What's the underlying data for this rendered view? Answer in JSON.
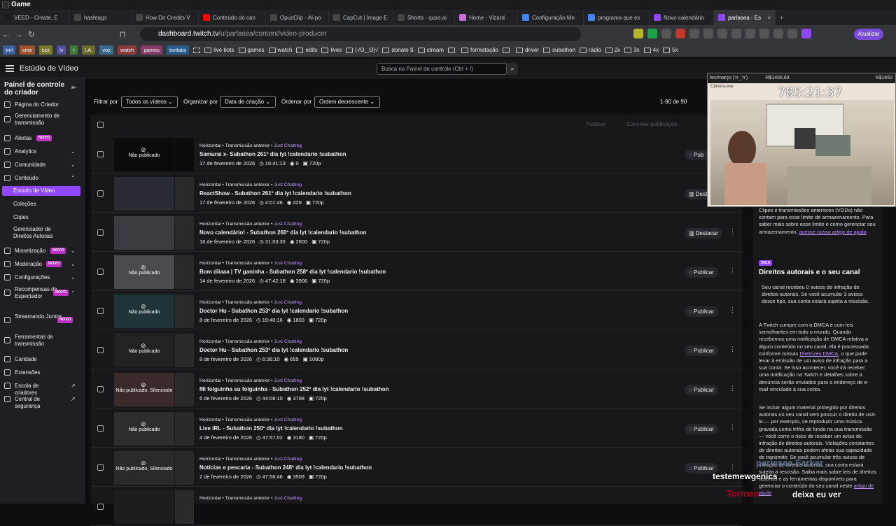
{
  "os": {
    "title": "Game"
  },
  "tabs": [
    {
      "label": "VEED - Create, E",
      "color": "#1c1c1c"
    },
    {
      "label": "hashtags",
      "color": "#444"
    },
    {
      "label": "How Do Credits V",
      "color": "#444"
    },
    {
      "label": "Conteúdo do can",
      "color": "#ff0000"
    },
    {
      "label": "OpusClip - AI-po",
      "color": "#444"
    },
    {
      "label": "CapCut | Image E",
      "color": "#444"
    },
    {
      "label": "Shorts - quso.ai",
      "color": "#444"
    },
    {
      "label": "Home - Vizard",
      "color": "#c86dd7"
    },
    {
      "label": "Configuração Me",
      "color": "#4285f4"
    },
    {
      "label": "programa que ex",
      "color": "#4285f4"
    },
    {
      "label": "Novo calendário",
      "color": "#9147ff"
    },
    {
      "label": "parlasea - Es",
      "color": "#9147ff",
      "active": true
    }
  ],
  "url": {
    "host": "dashboard.twitch.tv",
    "path": "/u/parlasea/content/video-producer"
  },
  "update_label": "Atualizar",
  "bookmarks": {
    "chips": [
      {
        "label": "tml",
        "color": "#3b5f9a"
      },
      {
        "label": "cine",
        "color": "#a0522d"
      },
      {
        "label": "ccz",
        "color": "#7a7a2a"
      },
      {
        "label": "lv",
        "color": "#4f4f9a"
      },
      {
        "label": "r",
        "color": "#3f7a3f"
      },
      {
        "label": "I.A.",
        "color": "#6b6b2a"
      },
      {
        "label": "voz",
        "color": "#3a6a8a"
      },
      {
        "label": "watch",
        "color": "#8a3a3a"
      },
      {
        "label": "games",
        "color": "#8a3a6a"
      },
      {
        "label": "botlabs",
        "color": "#2a5a8a"
      }
    ],
    "items": [
      "live bots",
      "games",
      "watch",
      "edits",
      "lives",
      "(√ʘ‿ʘ)√",
      "donate $",
      "stream",
      "",
      "formatação",
      "",
      "driver",
      "subathon",
      "rádio",
      "2x",
      "3x",
      "4x",
      "5x"
    ]
  },
  "header": {
    "studio_title": "Estúdio de Vídeo",
    "search_placeholder": "Busca no Painel de controle (Ctrl + /)"
  },
  "sidebar": {
    "title": "Painel de controle do criador",
    "new_badge": "NOVO",
    "items": [
      "Página do Criador",
      "Gerenciamento de transmissão",
      "Alertas",
      "Analytics",
      "Comunidade",
      "Conteúdo",
      "Estúdio de Vídeo",
      "Coleções",
      "Clipes",
      "Gerenciador de Direitos Autorais",
      "Monetização",
      "Moderação",
      "Configurações",
      "Recompensas de Espectador",
      "Streamando Juntos",
      "Ferramentas de transmissão",
      "Caridade",
      "Extensões",
      "Escola de criadores",
      "Central de segurança"
    ]
  },
  "filters": {
    "filter_label": "Filtrar por",
    "filter_value": "Todos os vídeos",
    "sort_label": "Organizar por",
    "sort_value": "Data de criação",
    "order_label": "Ordenar por",
    "order_value": "Ordem decrescente",
    "count": "1-90 de 90"
  },
  "list_header": {
    "publish": "Publicar",
    "cancel": "Cancelar publicação"
  },
  "rows": [
    {
      "meta": "Horizontal • Transmissão anterior •",
      "cat": "Just Chatting",
      "title": "Samurai x- Subathon 261º dia lyt !calendario !subathon",
      "date": "17 de fevereiro de 2026",
      "dur": "16:41:13",
      "views": "0",
      "res": "720p",
      "status": "Não publicado",
      "action": "Pub"
    },
    {
      "meta": "Horizontal • Transmissão anterior •",
      "cat": "Just Chatting",
      "title": "ReactShow - Subathon 261º dia lyt !calendario !subathon",
      "date": "17 de fevereiro de 2026",
      "dur": "4:01:46",
      "views": "429",
      "res": "720p",
      "status": "",
      "action": "Dest"
    },
    {
      "meta": "Horizontal • Transmissão anterior •",
      "cat": "Just Chatting",
      "title": "Novo calendário! - Subathon 260º dia lyt !calendario !subathon",
      "date": "16 de fevereiro de 2026",
      "dur": "31:03:35",
      "views": "2600",
      "res": "720p",
      "status": "",
      "action": "Destacar"
    },
    {
      "meta": "Horizontal • Transmissão anterior •",
      "cat": "Just Chatting",
      "title": "Bom diiaaa | TV ganinha - Subathon 258º dia lyt !calendario !subathon",
      "date": "14 de fevereiro de 2026",
      "dur": "47:42:18",
      "views": "3906",
      "res": "720p",
      "status": "Não publicado",
      "action": "Publicar"
    },
    {
      "meta": "Horizontal • Transmissão anterior •",
      "cat": "Just Chatting",
      "title": "Doctor Hu - Subathon 253º dia lyt !calendario !subathon",
      "date": "8 de fevereiro de 2026",
      "dur": "19:40:16",
      "views": "1803",
      "res": "720p",
      "status": "Não publicado",
      "action": "Publicar"
    },
    {
      "meta": "Horizontal • Transmissão anterior •",
      "cat": "Just Chatting",
      "title": "Doctor Hu - Subathon 253º dia lyt !calendario !subathon",
      "date": "8 de fevereiro de 2026",
      "dur": "6:36:10",
      "views": "655",
      "res": "1080p",
      "status": "Não publicado",
      "action": "Publicar"
    },
    {
      "meta": "Horizontal • Transmissão anterior •",
      "cat": "Just Chatting",
      "title": "Mi folguinha su folguinha - Subathon 252º dia lyt !calendario !subathon",
      "date": "6 de fevereiro de 2026",
      "dur": "44:08:10",
      "views": "3798",
      "res": "720p",
      "status": "Não publicado, Silenciado",
      "action": "Publicar"
    },
    {
      "meta": "Horizontal • Transmissão anterior •",
      "cat": "Just Chatting",
      "title": "Live IRL - Subathon 250º dia lyt !calendario !subathon",
      "date": "4 de fevereiro de 2026",
      "dur": "47:57:02",
      "views": "3180",
      "res": "720p",
      "status": "Não publicado",
      "action": "Publicar"
    },
    {
      "meta": "Horizontal • Transmissão anterior •",
      "cat": "Just Chatting",
      "title": "Notícias e pescaria - Subathon 248º dia lyt !calendario !subathon",
      "date": "2 de fevereiro de 2026",
      "dur": "47:56:46",
      "views": "3509",
      "res": "720p",
      "status": "Não publicado, Silenciado",
      "action": "Publicar"
    },
    {
      "meta": "Horizontal • Transmissão anterior •",
      "cat": "Just Chatting",
      "title": "",
      "date": "",
      "dur": "",
      "views": "",
      "res": "",
      "status": "",
      "action": ""
    }
  ],
  "camera": {
    "goal": "fev/março (ㅠ_ㅠ)",
    "amount": "R$1456,63",
    "amount2": "R$1650",
    "window": "Câmera.exe",
    "clock": "785:21:37"
  },
  "right_panel": {
    "p1": "Clipes e transmissões anteriores (VODs) não contam para esse limite de armazenamento. Para saber mais sobre esse limite e como gerenciar seu armazenamento,",
    "p1_link": "acesse nosso artigo de ajuda",
    "tip": "DICA",
    "title": "Direitos autorais e o seu canal",
    "p2": "Seu canal recebeu 0 avisos de infração de direitos autorais. Se você acumular 3 avisos desse tipo, sua conta estará sujeita a rescisão.",
    "p3": "A Twitch cumpre com a DMCA e com leis semelhantes em todo o mundo. Quando recebemos uma notificação de DMCA relativa a algum conteúdo no seu canal, ela é processada conforme nossas",
    "p3_link": "Diretrizes DMCA",
    "p3b": ", o que pode levar à emissão de um aviso de infração para a sua conta. Se isso acontecer, você irá receber uma notificação na Twitch e detalhes sobre a denúncia serão enviados para o endereço de e-mail vinculado à sua conta.",
    "p4": "Se incluir algum material protegido por direitos autorais no seu canal sem possuir o direito de usá-lo — por exemplo, se reproduzir uma música gravada como trilha de fundo na sua transmissão — você corre o risco de receber um aviso de infração de direitos autorais. Violações constantes de direitos autorais podem afetar sua capacidade de transmitir. Se você acumular três avisos de infração de direitos autorais, sua conta estará sujeita a rescisão. Saiba mais sobre leis de direitos autorais e as ferramentas disponíveis para gerenciar o conteúdo do seu canal neste",
    "p4_link": "artigo de ajuda"
  },
  "overlay": {
    "name1": "parlasea",
    "name1b": "Farker",
    "name2": "testemewgenics",
    "name3": "Tormen",
    "name4": "deixa eu ver"
  }
}
